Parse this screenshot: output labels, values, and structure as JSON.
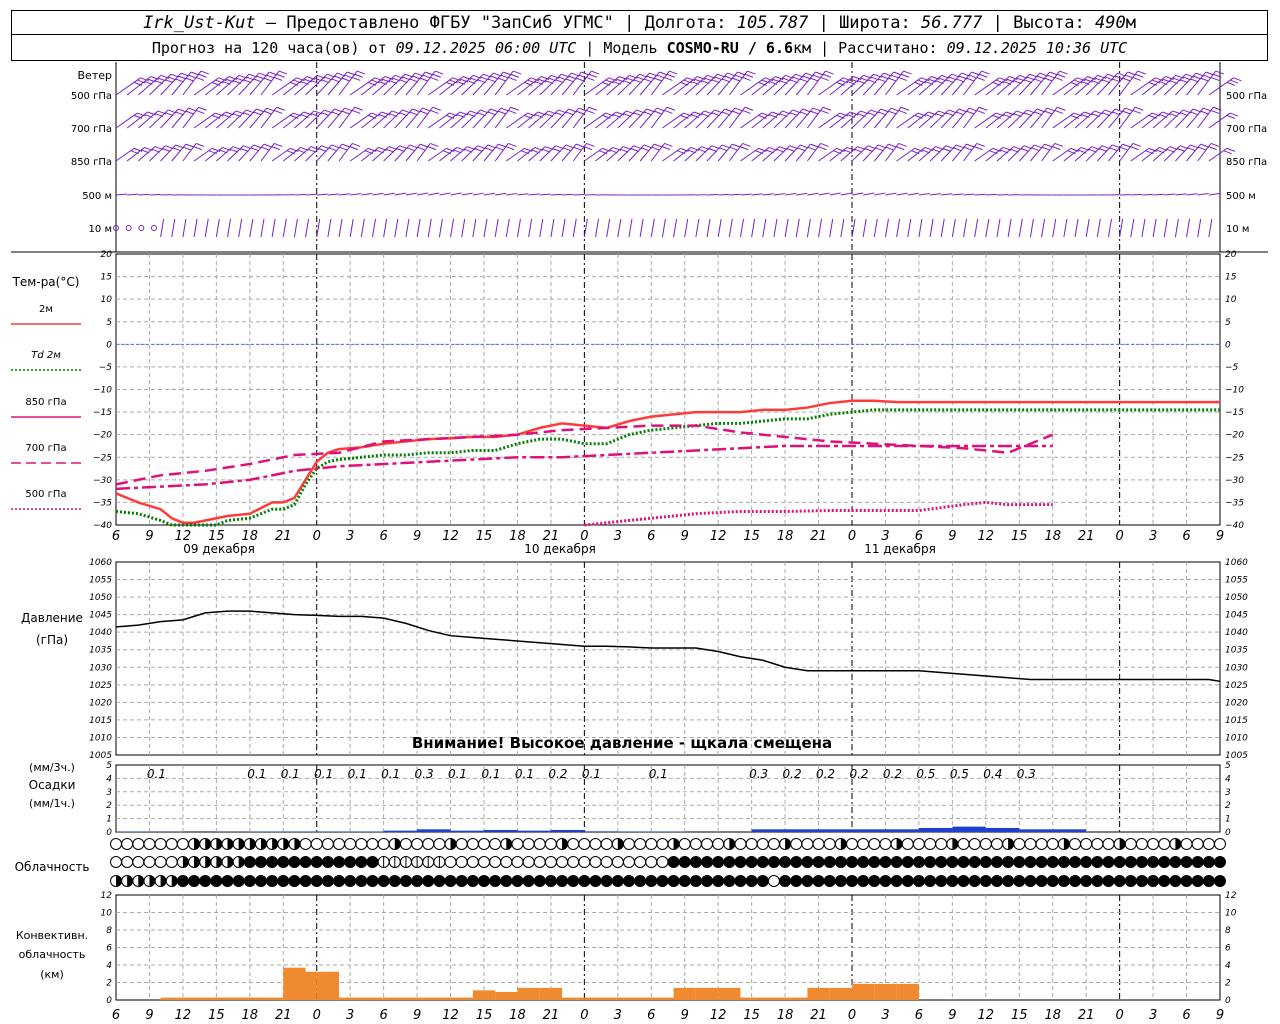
{
  "header": {
    "station": "Irk_Ust-Kut",
    "provided": " – Предоставлено ФГБУ \"ЗапСиб УГМС\" | Долгота: ",
    "lon": "105.787",
    "lat_label": " | Широта: ",
    "lat": "56.777",
    "alt_label": " | Высота: ",
    "alt": "490",
    "alt_unit": "м",
    "forecast_label": "Прогноз на 120 часа(ов) от ",
    "forecast_time": "09.12.2025 06:00 UTC",
    "model_label": " | Модель ",
    "model": "COSMO-RU / 6.6",
    "model_unit": "км",
    "computed_label": " | Рассчитано: ",
    "computed_time": "09.12.2025 10:36 UTC"
  },
  "wind_panel": {
    "title": "Ветер",
    "levels": [
      "500 гПа",
      "700 гПа",
      "850 гПа",
      "500 м",
      "10 м"
    ]
  },
  "temp_panel": {
    "title": "Тем-ра(°С)",
    "legend": [
      {
        "label": "2м",
        "color": "#ff3a3a",
        "style": "solid"
      },
      {
        "label": "Td 2м",
        "color": "#008000",
        "style": "dotted"
      },
      {
        "label": "850 гПа",
        "color": "#e0107a",
        "style": "solid"
      },
      {
        "label": "700 гПа",
        "color": "#e0107a",
        "style": "dashed"
      },
      {
        "label": "500 гПа",
        "color": "#e0107a",
        "style": "dotted"
      }
    ]
  },
  "day_labels": [
    "09 декабря",
    "10 декабря",
    "11 декабря"
  ],
  "pressure_panel": {
    "title": "Давление",
    "unit": "(гПа)",
    "warning": "Внимание! Высокое давление - щкала смещена"
  },
  "precip_panel": {
    "unit3": "(мм/3ч.)",
    "title": "Осадки",
    "unit1": "(мм/1ч.)",
    "labels": [
      {
        "h": 3,
        "v": "0.1"
      },
      {
        "h": 12,
        "v": "0.1"
      },
      {
        "h": 15,
        "v": "0.1"
      },
      {
        "h": 18,
        "v": "0.1"
      },
      {
        "h": 21,
        "v": "0.1"
      },
      {
        "h": 24,
        "v": "0.1"
      },
      {
        "h": 27,
        "v": "0.3"
      },
      {
        "h": 30,
        "v": "0.1"
      },
      {
        "h": 33,
        "v": "0.1"
      },
      {
        "h": 36,
        "v": "0.1"
      },
      {
        "h": 39,
        "v": "0.2"
      },
      {
        "h": 42,
        "v": "0.1"
      },
      {
        "h": 48,
        "v": "0.1"
      },
      {
        "h": 57,
        "v": "0.3"
      },
      {
        "h": 60,
        "v": "0.2"
      },
      {
        "h": 63,
        "v": "0.2"
      },
      {
        "h": 66,
        "v": "0.2"
      },
      {
        "h": 69,
        "v": "0.2"
      },
      {
        "h": 72,
        "v": "0.5"
      },
      {
        "h": 75,
        "v": "0.5"
      },
      {
        "h": 78,
        "v": "0.4"
      },
      {
        "h": 81,
        "v": "0.3"
      }
    ]
  },
  "cloud_panel": {
    "title": "Облачность"
  },
  "conv_panel": {
    "title1": "Конвективн.",
    "title2": "облачность",
    "unit": "(км)"
  },
  "colors": {
    "t2m": "#ff3a3a",
    "td": "#008000",
    "upper": "#e0107a",
    "wind": "#7a20c8",
    "precip": "#1f3fd0",
    "conv": "#f08a30",
    "zero": "#4a6cff"
  },
  "chart_data": [
    {
      "type": "line",
      "title": "Тем-ра(°С)",
      "ylim": [
        -40,
        20
      ],
      "x_hours_from_start": [
        0,
        3,
        6,
        9,
        12,
        15,
        18,
        21,
        24,
        27,
        30,
        33,
        36,
        39,
        42,
        45,
        48,
        51,
        54,
        57,
        60,
        63,
        66,
        69,
        72,
        75,
        78,
        81,
        84
      ],
      "x_tick_labels": [
        "6",
        "9",
        "12",
        "15",
        "18",
        "21",
        "0",
        "3",
        "6",
        "9",
        "12",
        "15",
        "18",
        "21",
        "0",
        "3",
        "6",
        "9",
        "12",
        "15",
        "18",
        "21",
        "0",
        "3",
        "6",
        "9",
        "12",
        "15",
        "18",
        "21",
        "0",
        "3",
        "6",
        "9",
        "12"
      ],
      "series": [
        {
          "name": "2м",
          "x": [
            0,
            2,
            4,
            5,
            6,
            7,
            8,
            9,
            10,
            12,
            14,
            15,
            16,
            17,
            18,
            19,
            20,
            22,
            24,
            26,
            28,
            30,
            32,
            34,
            36,
            38,
            40,
            42,
            44,
            46,
            48,
            50,
            52,
            54,
            56,
            58,
            60,
            62,
            64,
            66,
            68,
            70,
            72,
            74,
            76,
            78,
            80,
            82,
            84,
            86,
            88,
            90,
            92,
            94,
            96,
            98,
            99
          ],
          "y": [
            -33,
            -35,
            -36.5,
            -38.5,
            -39.5,
            -39.5,
            -39,
            -38.5,
            -38,
            -37.5,
            -35,
            -35,
            -34,
            -30,
            -26,
            -24,
            -23.2,
            -22.8,
            -22,
            -21.5,
            -21,
            -20.8,
            -20.5,
            -20.5,
            -20,
            -18.5,
            -17.5,
            -18,
            -18.5,
            -17,
            -16,
            -15.5,
            -15,
            -15,
            -15,
            -14.5,
            -14.5,
            -14,
            -13,
            -12.5,
            -12.5,
            -12.8,
            -12.8,
            -12.8,
            -12.8,
            -12.8,
            -12.8,
            -12.8,
            -12.8,
            -12.8,
            -12.8,
            -12.8,
            -12.8,
            -12.8,
            -12.8,
            -12.8,
            -12.8
          ]
        },
        {
          "name": "Td 2м",
          "x": [
            0,
            2,
            4,
            5,
            6,
            7,
            8,
            9,
            10,
            12,
            14,
            15,
            16,
            17,
            18,
            19,
            20,
            22,
            24,
            26,
            28,
            30,
            32,
            34,
            36,
            38,
            40,
            42,
            44,
            46,
            48,
            50,
            52,
            54,
            56,
            58,
            60,
            62,
            64,
            66,
            68,
            70,
            72,
            99
          ],
          "y": [
            -37,
            -37.5,
            -39,
            -40,
            -41,
            -41,
            -41,
            -40,
            -39,
            -38.5,
            -36.5,
            -36.5,
            -35.5,
            -31,
            -27.5,
            -26,
            -25.5,
            -25,
            -24.5,
            -24.5,
            -24,
            -24,
            -23.5,
            -23.5,
            -22,
            -21,
            -21,
            -22,
            -22,
            -20,
            -19,
            -18.5,
            -18,
            -17.5,
            -17.5,
            -17,
            -16.5,
            -16.5,
            -15.5,
            -15,
            -14.5,
            -14.5,
            -14.5,
            -14.5
          ]
        },
        {
          "name": "850 гПа",
          "x": [
            0,
            4,
            8,
            12,
            16,
            20,
            24,
            28,
            32,
            36,
            40,
            44,
            48,
            52,
            56,
            60,
            64,
            68,
            72,
            76,
            80,
            84
          ],
          "y": [
            -32,
            -31.5,
            -31,
            -30,
            -28,
            -27,
            -26.5,
            -26,
            -25.5,
            -25,
            -25,
            -24.5,
            -24,
            -23.5,
            -23,
            -22.5,
            -22.5,
            -22.5,
            -22.5,
            -22.5,
            -22.5,
            -22.5
          ]
        },
        {
          "name": "700 гПа",
          "x": [
            0,
            4,
            8,
            12,
            16,
            20,
            24,
            28,
            32,
            36,
            40,
            44,
            48,
            52,
            56,
            60,
            64,
            68,
            72,
            76,
            80,
            84
          ],
          "y": [
            -31,
            -29,
            -28,
            -26.5,
            -24.5,
            -24,
            -21.5,
            -21,
            -20.5,
            -20,
            -19,
            -18.5,
            -18,
            -18,
            -19.5,
            -20.5,
            -21.5,
            -22,
            -22.5,
            -23,
            -24,
            -20
          ]
        },
        {
          "name": "500 гПа",
          "x": [
            42,
            44,
            46,
            48,
            52,
            56,
            60,
            64,
            68,
            72,
            76,
            78,
            80,
            84
          ],
          "y": [
            -40,
            -39.5,
            -39,
            -38.5,
            -37.5,
            -37,
            -37,
            -36.8,
            -36.8,
            -36.8,
            -35.5,
            -35,
            -35.5,
            -35.5
          ]
        }
      ]
    },
    {
      "type": "line",
      "title": "Давление",
      "ylabel": "(гПа)",
      "ylim": [
        1005,
        1060
      ],
      "series": [
        {
          "name": "Давление",
          "x": [
            0,
            2,
            4,
            6,
            8,
            10,
            12,
            14,
            16,
            18,
            20,
            22,
            24,
            26,
            28,
            30,
            32,
            34,
            36,
            38,
            40,
            42,
            44,
            46,
            48,
            50,
            52,
            54,
            56,
            58,
            60,
            62,
            64,
            66,
            68,
            70,
            72,
            74,
            76,
            78,
            80,
            82,
            84,
            86,
            88,
            90,
            92,
            94,
            96,
            98,
            99
          ],
          "y": [
            1041.5,
            1042,
            1043,
            1043.5,
            1045.5,
            1046,
            1046,
            1045.5,
            1045,
            1044.8,
            1044.5,
            1044.5,
            1044,
            1042.5,
            1040.5,
            1039,
            1038.5,
            1038,
            1037.5,
            1037,
            1036.5,
            1036,
            1036,
            1035.8,
            1035.5,
            1035.5,
            1035.5,
            1034.5,
            1033,
            1032,
            1030,
            1029,
            1029,
            1029,
            1029,
            1029,
            1029,
            1028.5,
            1028,
            1027.5,
            1027,
            1026.5,
            1026.5,
            1026.5,
            1026.5,
            1026.5,
            1026.5,
            1026.5,
            1026.5,
            1026.5,
            1026
          ]
        }
      ]
    },
    {
      "type": "bar",
      "title": "Осадки",
      "ylabel": "(мм/1ч.)",
      "ylim": [
        0,
        5
      ],
      "x_hours": [
        0,
        3,
        6,
        9,
        12,
        15,
        18,
        21,
        24,
        27,
        30,
        33,
        36,
        39,
        42,
        45,
        48,
        51,
        54,
        57,
        60,
        63,
        66,
        69,
        72,
        75,
        78,
        81,
        84
      ],
      "values": [
        0.03,
        0.02,
        0,
        0.02,
        0.03,
        0.03,
        0.03,
        0.03,
        0.1,
        0.2,
        0.1,
        0.15,
        0.1,
        0.15,
        0.05,
        0.03,
        0.03,
        0,
        0,
        0.2,
        0.2,
        0.2,
        0.2,
        0.2,
        0.3,
        0.4,
        0.3,
        0.2,
        0.2
      ]
    },
    {
      "type": "bar",
      "title": "Конвективн. облачность",
      "ylabel": "(км)",
      "ylim": [
        0,
        13
      ],
      "x_hours": [
        4,
        6,
        8,
        9,
        10,
        11,
        12,
        14,
        15,
        16,
        18,
        20,
        22,
        24,
        26,
        28,
        30,
        32,
        34,
        36,
        38,
        40,
        42,
        44,
        46,
        48,
        50,
        52,
        54,
        56,
        58,
        60,
        62,
        64,
        66,
        68,
        70
      ],
      "values": [
        0.3,
        0.3,
        0.3,
        0.3,
        0.3,
        0.3,
        0.3,
        0.3,
        4.0,
        3.5,
        3.5,
        0.3,
        0.3,
        0.3,
        0.3,
        0.3,
        0.3,
        1.2,
        1.0,
        1.5,
        1.5,
        0.3,
        0.3,
        0.3,
        0.3,
        0.3,
        1.5,
        1.5,
        1.5,
        0.3,
        0.3,
        0.3,
        1.5,
        1.5,
        2.0,
        2.0,
        2.0
      ]
    }
  ]
}
